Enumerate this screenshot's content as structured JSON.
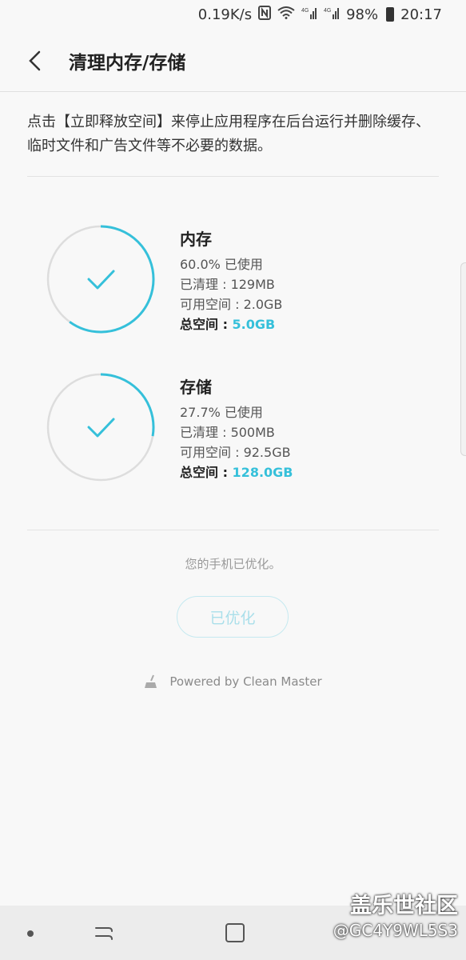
{
  "status_bar": {
    "speed": "0.19K/s",
    "battery_pct": "98%",
    "time": "20:17",
    "network_label": "4G"
  },
  "app_bar": {
    "title": "清理内存/存储"
  },
  "description": "点击【立即释放空间】来停止应用程序在后台运行并删除缓存、临时文件和广告文件等不必要的数据。",
  "memory": {
    "title": "内存",
    "used": "60.0% 已使用",
    "used_fraction": 0.6,
    "cleaned": "已清理 : 129MB",
    "available": "可用空间 : 2.0GB",
    "total_label": "总空间 : ",
    "total_value": "5.0GB"
  },
  "storage": {
    "title": "存储",
    "used": "27.7% 已使用",
    "used_fraction": 0.277,
    "cleaned": "已清理 : 500MB",
    "available": "可用空间 : 92.5GB",
    "total_label": "总空间 : ",
    "total_value": "128.0GB"
  },
  "status_message": "您的手机已优化。",
  "optimize_button": "已优化",
  "powered_by": "Powered by Clean Master",
  "watermark": {
    "main": "盖乐世社区",
    "sub": "@GC4Y9WL5S3"
  },
  "colors": {
    "accent": "#35c0da",
    "ring_track": "#dddddd"
  }
}
